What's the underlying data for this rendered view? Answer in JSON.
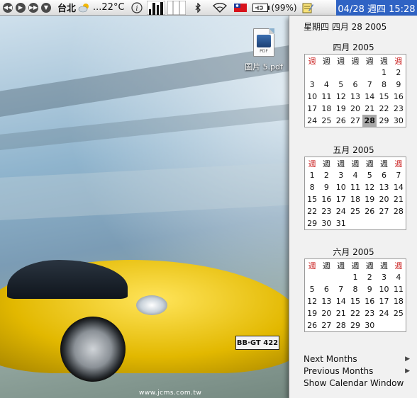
{
  "menubar": {
    "media_buttons": [
      "prev-icon",
      "play-icon",
      "next-icon",
      "eject-icon"
    ],
    "weather": {
      "city": "台北",
      "icon": "cloud-sun-icon",
      "temp": "...22°C"
    },
    "status_icons": [
      "info-icon",
      "cpu-meter-icon",
      "disk-meter-icon",
      "bluetooth-icon",
      "wifi-icon",
      "flag-icon",
      "battery-icon",
      "note-icon"
    ],
    "battery_pct": "(99%)",
    "clock": "04/28 週四 15:28"
  },
  "desktop": {
    "file": {
      "name": "圖片 5.pdf",
      "badge": "PDF"
    },
    "plate": "BB·GT 422",
    "watermark": "www.jcms.com.tw"
  },
  "menu": {
    "current_date": "星期四 四月 28 2005",
    "weekday_header": [
      "週",
      "週",
      "週",
      "週",
      "週",
      "週",
      "週"
    ],
    "months": [
      {
        "title": "四月 2005",
        "first_weekday": 5,
        "days": 30,
        "today": 28
      },
      {
        "title": "五月 2005",
        "first_weekday": 0,
        "days": 31,
        "today": null
      },
      {
        "title": "六月 2005",
        "first_weekday": 3,
        "days": 30,
        "today": null
      }
    ],
    "items": [
      {
        "label": "Next Months",
        "submenu": true
      },
      {
        "label": "Previous Months",
        "submenu": true
      },
      {
        "label": "Show Calendar Window",
        "submenu": false
      }
    ]
  }
}
